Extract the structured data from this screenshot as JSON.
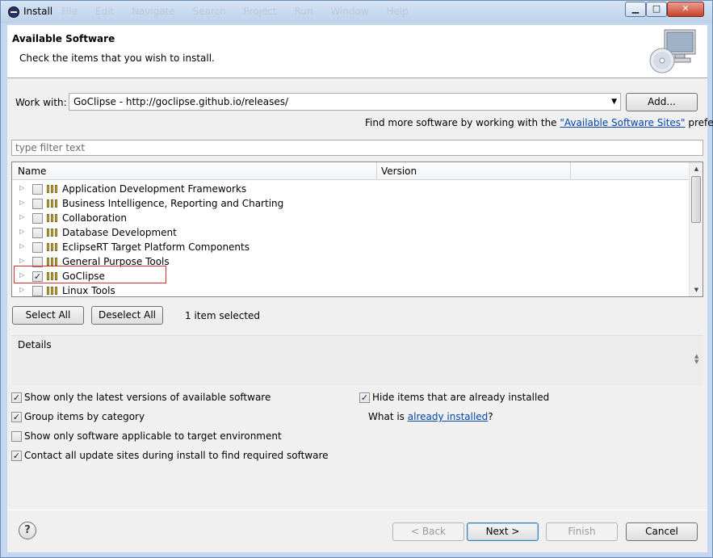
{
  "window": {
    "title": "Install",
    "ghost_menu": "File Edit Navigate Search Project Run Window Help"
  },
  "banner": {
    "title": "Available Software",
    "description": "Check the items that you wish to install."
  },
  "work_with": {
    "label": "Work with:",
    "value": "GoClipse - http://goclipse.github.io/releases/",
    "add_button": "Add...",
    "more_prefix": "Find more software by working with the ",
    "more_link": "\"Available Software Sites\"",
    "more_suffix": " preferences."
  },
  "filter": {
    "placeholder": "type filter text"
  },
  "tree": {
    "columns": [
      "Name",
      "Version"
    ],
    "items": [
      {
        "label": "Application Development Frameworks",
        "checked": false
      },
      {
        "label": "Business Intelligence, Reporting and Charting",
        "checked": false
      },
      {
        "label": "Collaboration",
        "checked": false
      },
      {
        "label": "Database Development",
        "checked": false
      },
      {
        "label": "EclipseRT Target Platform Components",
        "checked": false
      },
      {
        "label": "General Purpose Tools",
        "checked": false
      },
      {
        "label": "GoClipse",
        "checked": true
      },
      {
        "label": "Linux Tools",
        "checked": false
      }
    ]
  },
  "selection": {
    "select_all": "Select All",
    "deselect_all": "Deselect All",
    "status": "1 item selected"
  },
  "details": {
    "title": "Details"
  },
  "options": {
    "latest_only": {
      "label": "Show only the latest versions of available software",
      "checked": true
    },
    "group_by_category": {
      "label": "Group items by category",
      "checked": true
    },
    "target_env_only": {
      "label": "Show only software applicable to target environment",
      "checked": false
    },
    "contact_sites": {
      "label": "Contact all update sites during install to find required software",
      "checked": true
    },
    "hide_installed": {
      "label": "Hide items that are already installed",
      "checked": true
    },
    "what_is_prefix": "What is ",
    "what_is_link": "already installed",
    "what_is_suffix": "?"
  },
  "footer": {
    "help": "?",
    "back": "< Back",
    "next": "Next >",
    "finish": "Finish",
    "cancel": "Cancel"
  },
  "colors": {
    "highlight_border": "#d6303a",
    "link": "#0645ad"
  }
}
